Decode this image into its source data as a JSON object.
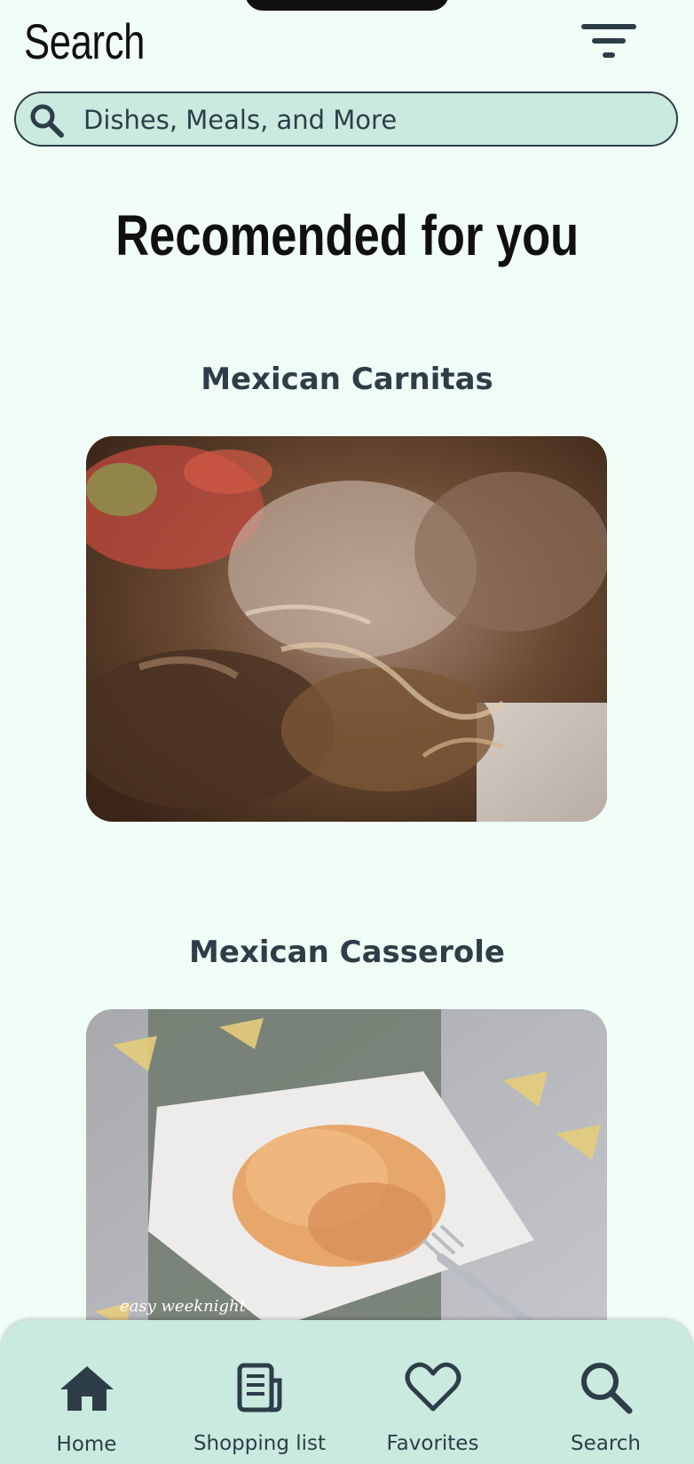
{
  "header": {
    "title": "Search"
  },
  "search": {
    "placeholder": "Dishes, Meals, and More"
  },
  "recommended": {
    "heading": "Recomended for you",
    "items": [
      {
        "title": "Mexican Carnitas"
      },
      {
        "title": "Mexican Casserole",
        "image_caption": "easy weeknight"
      }
    ]
  },
  "nav": {
    "items": [
      {
        "label": "Home",
        "icon": "home-icon"
      },
      {
        "label": "Shopping list",
        "icon": "list-icon"
      },
      {
        "label": "Favorites",
        "icon": "heart-icon"
      },
      {
        "label": "Search",
        "icon": "search-icon"
      }
    ]
  },
  "colors": {
    "background": "#F1FEF7",
    "accent_surface": "#CAE9DF",
    "text_dark": "#2D3E48"
  }
}
